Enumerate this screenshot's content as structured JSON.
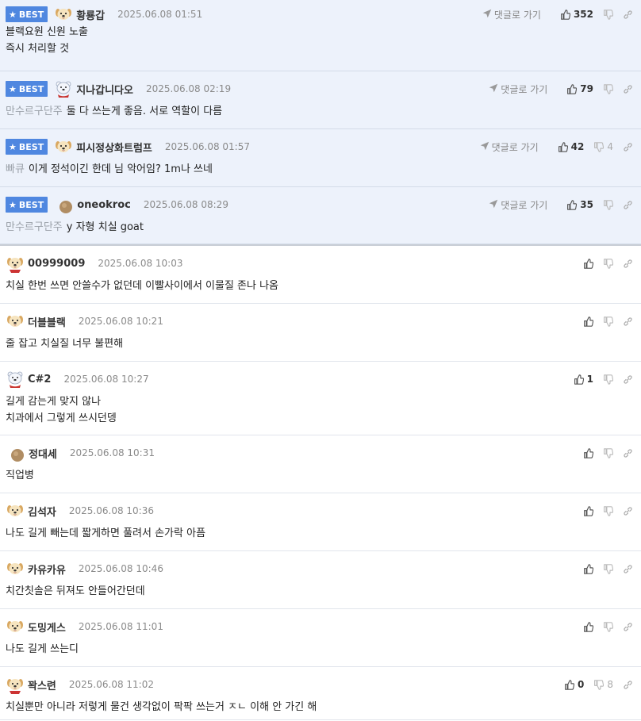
{
  "best_label": "BEST",
  "reply_link_label": "댓글로 가기",
  "best_comments": [
    {
      "nick": "황룡갑",
      "avatar": "dog",
      "date": "2025.06.08 01:51",
      "lines": [
        "블랙요원 신원 노출",
        "즉시 처리할 것"
      ],
      "reply_to": "",
      "up": "352",
      "down": ""
    },
    {
      "nick": "지나갑니다오",
      "avatar": "bear",
      "date": "2025.06.08 02:19",
      "lines": [
        "둘 다 쓰는게 좋음. 서로 역할이 다름"
      ],
      "reply_to": "만수르구단주",
      "up": "79",
      "down": ""
    },
    {
      "nick": "피시정상화트럼프",
      "avatar": "dog",
      "date": "2025.06.08 01:57",
      "lines": [
        "이게 정석이긴 한데 님 악어임? 1m나 쓰네"
      ],
      "reply_to": "빠큐",
      "up": "42",
      "down": "4"
    },
    {
      "nick": "oneokroc",
      "avatar": "dot",
      "date": "2025.06.08 08:29",
      "lines": [
        "y 자형 치실 goat"
      ],
      "reply_to": "만수르구단주",
      "up": "35",
      "down": ""
    }
  ],
  "comments": [
    {
      "nick": "00999009",
      "avatar": "dogred",
      "date": "2025.06.08 10:03",
      "lines": [
        "치실 한번 쓰면 안쓸수가 없던데 이빨사이에서 이물질 존나 나옴"
      ],
      "up": "",
      "down": ""
    },
    {
      "nick": "더블블랙",
      "avatar": "dog",
      "date": "2025.06.08 10:21",
      "lines": [
        "줄 잡고 치실질 너무 불편해"
      ],
      "up": "",
      "down": ""
    },
    {
      "nick": "C#2",
      "avatar": "bear",
      "date": "2025.06.08 10:27",
      "lines": [
        "길게 감는게 맞지 않나",
        "치과에서 그렇게 쓰시던뎅"
      ],
      "up": "1",
      "down": ""
    },
    {
      "nick": "정대세",
      "avatar": "dot",
      "date": "2025.06.08 10:31",
      "lines": [
        "직업병"
      ],
      "up": "",
      "down": ""
    },
    {
      "nick": "김석자",
      "avatar": "dog",
      "date": "2025.06.08 10:36",
      "lines": [
        "나도 길게 빼는데 짧게하면 풀려서 손가락 아픔"
      ],
      "up": "",
      "down": ""
    },
    {
      "nick": "카유카유",
      "avatar": "dog",
      "date": "2025.06.08 10:46",
      "lines": [
        "치간칫솔은 뒤져도 안들어간던데"
      ],
      "up": "",
      "down": ""
    },
    {
      "nick": "도밍게스",
      "avatar": "dog",
      "date": "2025.06.08 11:01",
      "lines": [
        "나도 길게 쓰는디"
      ],
      "up": "",
      "down": ""
    },
    {
      "nick": "꽉스련",
      "avatar": "dogred",
      "date": "2025.06.08 11:02",
      "lines": [
        "치실뿐만 아니라 저렇게 물건 생각없이 팍팍 쓰는거 ㅈㄴ 이해 안 가긴 해"
      ],
      "up": "0",
      "down": "8"
    }
  ],
  "colors": {
    "best_bg": "#edf2fb",
    "badge": "#4f87e0"
  }
}
